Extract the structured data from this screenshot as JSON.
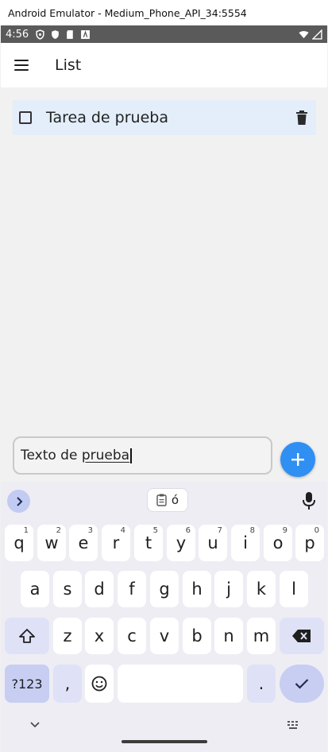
{
  "window": {
    "title": "Android Emulator - Medium_Phone_API_34:5554"
  },
  "status_bar": {
    "time": "4:56"
  },
  "app_bar": {
    "title": "List"
  },
  "tasks": [
    {
      "label": "Tarea de prueba"
    }
  ],
  "input": {
    "value_prefix": "Texto de ",
    "value_underlined": "prueba"
  },
  "keyboard": {
    "suggestion": "ó",
    "row1": [
      {
        "k": "q",
        "hint": "1"
      },
      {
        "k": "w",
        "hint": "2"
      },
      {
        "k": "e",
        "hint": "3"
      },
      {
        "k": "r",
        "hint": "4"
      },
      {
        "k": "t",
        "hint": "5"
      },
      {
        "k": "y",
        "hint": "6"
      },
      {
        "k": "u",
        "hint": "7"
      },
      {
        "k": "i",
        "hint": "8"
      },
      {
        "k": "o",
        "hint": "9"
      },
      {
        "k": "p",
        "hint": "0"
      }
    ],
    "row2": [
      "a",
      "s",
      "d",
      "f",
      "g",
      "h",
      "j",
      "k",
      "l"
    ],
    "row3": [
      "z",
      "x",
      "c",
      "v",
      "b",
      "n",
      "m"
    ],
    "symbols_label": "?123",
    "comma": ",",
    "period": "."
  },
  "colors": {
    "accent": "#2f8ff3",
    "task_bg": "#e3eefa",
    "status_bar": "#5a5a5a"
  }
}
